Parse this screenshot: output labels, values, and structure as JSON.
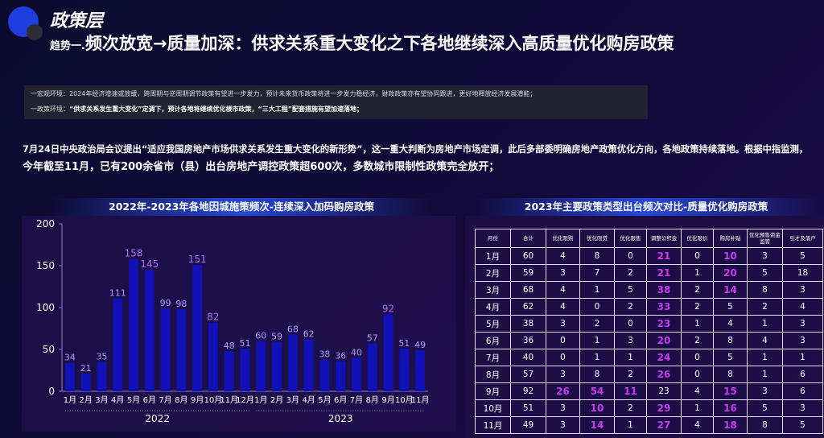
{
  "header": {
    "layer_title": "政策层",
    "headline_prefix": "趋势一.",
    "headline": "频次放宽→质量加深：供求关系重大变化之下各地继续深入高质量优化购房政策"
  },
  "info": {
    "macro_label": "一宏观环境：",
    "macro_text": "2024年经济增速或放缓，跨周期与逆周期调节政策有望进一步发力，预计未来货币政策将进一步发力稳经济，财政政策亦有望协同跟进，更好地释放经济发展潜能；",
    "policy_label": "一政策环境：",
    "policy_text": "“供求关系发生重大变化”定调下，预计各地将继续优化楼市政策，“三大工程”配套措施有望加速落地；"
  },
  "paragraph": {
    "line1": "7月24日中央政治局会议提出“适应我国房地产市场供求关系发生重大变化的新形势”，这一重大判断为房地产市场定调，此后多部委明确房地产政策优化方向，各地政策持续落地。根据中指监测，",
    "line2": "今年截至11月，已有200余省市（县）出台房地产调控政策超600次，多数城市限制性政策完全放开；"
  },
  "chart_title": "2022年-2023年各地因城施策频次-连续深入加码购房政策",
  "table_title": "2023年主要政策类型出台频次对比-质量优化购房政策",
  "chart_data": {
    "type": "bar",
    "title": "2022年-2023年各地因城施策频次-连续深入加码购房政策",
    "categories": [
      "1月",
      "2月",
      "3月",
      "4月",
      "5月",
      "6月",
      "7月",
      "8月",
      "9月",
      "10月",
      "11月",
      "12月",
      "1月",
      "2月",
      "3月",
      "4月",
      "5月",
      "6月",
      "7月",
      "8月",
      "9月",
      "10月",
      "11月"
    ],
    "values": [
      34,
      21,
      35,
      111,
      158,
      145,
      99,
      98,
      151,
      82,
      48,
      51,
      60,
      59,
      68,
      62,
      38,
      36,
      40,
      57,
      92,
      51,
      49
    ],
    "highlight_indexes": [
      4,
      5,
      8,
      9,
      20
    ],
    "groups": [
      {
        "label": "2022",
        "start": 0,
        "end": 11
      },
      {
        "label": "2023",
        "start": 12,
        "end": 22
      }
    ],
    "ylim": [
      0,
      200
    ],
    "yticks": [
      0,
      50,
      100,
      150,
      200
    ],
    "bar_color": "#1111b8",
    "label_color": "#a59bff",
    "highlight_label_color": "#b06df0",
    "grid": false
  },
  "policy_table": {
    "headers": [
      "月份",
      "合计",
      "优化限购",
      "优化限贷",
      "优化限售",
      "调整公积金",
      "优化限价",
      "购房补贴",
      "优化预售资金监管",
      "引才及落户"
    ],
    "rows": [
      [
        "1月",
        "60",
        "4",
        "8",
        "0",
        "21",
        "0",
        "10",
        "3",
        "5"
      ],
      [
        "2月",
        "59",
        "3",
        "7",
        "2",
        "21",
        "1",
        "20",
        "5",
        "18"
      ],
      [
        "3月",
        "68",
        "4",
        "1",
        "5",
        "38",
        "2",
        "14",
        "8",
        "3"
      ],
      [
        "4月",
        "62",
        "4",
        "0",
        "2",
        "33",
        "2",
        "5",
        "2",
        "4"
      ],
      [
        "5月",
        "38",
        "3",
        "2",
        "0",
        "23",
        "1",
        "4",
        "1",
        "3"
      ],
      [
        "6月",
        "36",
        "0",
        "1",
        "3",
        "20",
        "2",
        "8",
        "4",
        "3"
      ],
      [
        "7月",
        "40",
        "0",
        "1",
        "1",
        "24",
        "0",
        "5",
        "1",
        "1"
      ],
      [
        "8月",
        "57",
        "3",
        "8",
        "2",
        "26",
        "0",
        "8",
        "1",
        "6"
      ],
      [
        "9月",
        "92",
        "26",
        "54",
        "11",
        "23",
        "4",
        "15",
        "3",
        "6"
      ],
      [
        "10月",
        "51",
        "3",
        "10",
        "2",
        "29",
        "1",
        "16",
        "5",
        "3"
      ],
      [
        "11月",
        "49",
        "3",
        "14",
        "1",
        "27",
        "4",
        "18",
        "8",
        "5"
      ]
    ],
    "highlight": [
      [
        5,
        7
      ],
      [
        5,
        7
      ],
      [
        5,
        7
      ],
      [
        5
      ],
      [
        5
      ],
      [
        5
      ],
      [
        5
      ],
      [
        5
      ],
      [
        2,
        3,
        4,
        7
      ],
      [
        3,
        5,
        7
      ],
      [
        3,
        5,
        7
      ]
    ]
  }
}
